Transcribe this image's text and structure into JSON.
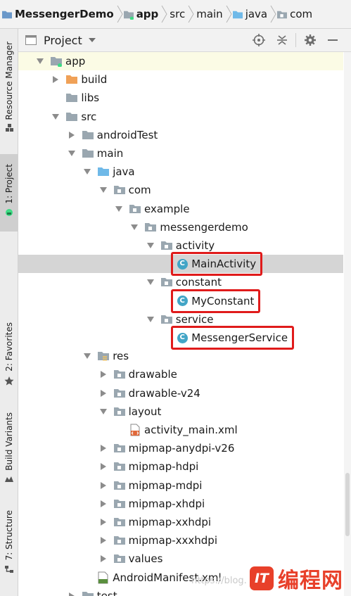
{
  "breadcrumb": {
    "items": [
      {
        "label": "MessengerDemo",
        "bold": true,
        "icon": "project-folder-icon"
      },
      {
        "label": "app",
        "bold": true,
        "icon": "module-folder-icon"
      },
      {
        "label": "src",
        "bold": false,
        "icon": "none"
      },
      {
        "label": "main",
        "bold": false,
        "icon": "none"
      },
      {
        "label": "java",
        "bold": false,
        "icon": "source-folder-icon"
      },
      {
        "label": "com",
        "bold": false,
        "icon": "package-icon"
      }
    ]
  },
  "side_strip": {
    "resource_manager": "Resource Manager",
    "project": "1: Project",
    "favorites": "2: Favorites",
    "build_variants": "Build Variants",
    "structure": "7: Structure"
  },
  "panel": {
    "title": "Project",
    "icons": [
      "locate-icon",
      "collapse-icon",
      "settings-icon",
      "hide-icon"
    ]
  },
  "tree": {
    "rows": [
      {
        "label": "app",
        "depth": 0,
        "arrow": "down",
        "icon": "module",
        "highlight": true
      },
      {
        "label": "build",
        "depth": 1,
        "arrow": "right",
        "icon": "folder-orange"
      },
      {
        "label": "libs",
        "depth": 1,
        "arrow": "none",
        "icon": "folder"
      },
      {
        "label": "src",
        "depth": 1,
        "arrow": "down",
        "icon": "folder"
      },
      {
        "label": "androidTest",
        "depth": 2,
        "arrow": "right",
        "icon": "folder"
      },
      {
        "label": "main",
        "depth": 2,
        "arrow": "down",
        "icon": "folder"
      },
      {
        "label": "java",
        "depth": 3,
        "arrow": "down",
        "icon": "folder-blue"
      },
      {
        "label": "com",
        "depth": 4,
        "arrow": "down",
        "icon": "package"
      },
      {
        "label": "example",
        "depth": 5,
        "arrow": "down",
        "icon": "package"
      },
      {
        "label": "messengerdemo",
        "depth": 6,
        "arrow": "down",
        "icon": "package"
      },
      {
        "label": "activity",
        "depth": 7,
        "arrow": "down",
        "icon": "package"
      },
      {
        "label": "MainActivity",
        "depth": 8,
        "arrow": "none",
        "icon": "class",
        "selected": true,
        "boxed": true
      },
      {
        "label": "constant",
        "depth": 7,
        "arrow": "down",
        "icon": "package"
      },
      {
        "label": "MyConstant",
        "depth": 8,
        "arrow": "none",
        "icon": "class",
        "boxed": true
      },
      {
        "label": "service",
        "depth": 7,
        "arrow": "down",
        "icon": "package"
      },
      {
        "label": "MessengerService",
        "depth": 8,
        "arrow": "none",
        "icon": "class",
        "boxed": true
      },
      {
        "label": "res",
        "depth": 3,
        "arrow": "down",
        "icon": "res-folder"
      },
      {
        "label": "drawable",
        "depth": 4,
        "arrow": "right",
        "icon": "package"
      },
      {
        "label": "drawable-v24",
        "depth": 4,
        "arrow": "right",
        "icon": "package"
      },
      {
        "label": "layout",
        "depth": 4,
        "arrow": "down",
        "icon": "package"
      },
      {
        "label": "activity_main.xml",
        "depth": 5,
        "arrow": "none",
        "icon": "xml"
      },
      {
        "label": "mipmap-anydpi-v26",
        "depth": 4,
        "arrow": "right",
        "icon": "package"
      },
      {
        "label": "mipmap-hdpi",
        "depth": 4,
        "arrow": "right",
        "icon": "package"
      },
      {
        "label": "mipmap-mdpi",
        "depth": 4,
        "arrow": "right",
        "icon": "package"
      },
      {
        "label": "mipmap-xhdpi",
        "depth": 4,
        "arrow": "right",
        "icon": "package"
      },
      {
        "label": "mipmap-xxhdpi",
        "depth": 4,
        "arrow": "right",
        "icon": "package"
      },
      {
        "label": "mipmap-xxxhdpi",
        "depth": 4,
        "arrow": "right",
        "icon": "package"
      },
      {
        "label": "values",
        "depth": 4,
        "arrow": "right",
        "icon": "package"
      },
      {
        "label": "AndroidManifest.xml",
        "depth": 3,
        "arrow": "none",
        "icon": "manifest"
      },
      {
        "label": "test",
        "depth": 2,
        "arrow": "right",
        "icon": "folder"
      }
    ]
  },
  "watermark": {
    "url": "https://blog.",
    "logo_text": "编程网",
    "badge": "IT"
  },
  "colors": {
    "highlight_box": "#e01b1b",
    "class_icon": "#42a5c6",
    "folder_grey": "#9aa7b0",
    "folder_orange": "#f0a157",
    "folder_blue": "#6fb9e8",
    "selection": "#d5d5d5",
    "row_highlight": "#fbfbe5"
  }
}
